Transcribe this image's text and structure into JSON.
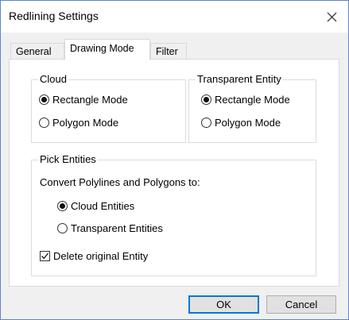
{
  "window": {
    "title": "Redlining Settings"
  },
  "tabs": [
    {
      "label": "General",
      "active": false
    },
    {
      "label": "Drawing Mode",
      "active": true
    },
    {
      "label": "Filter",
      "active": false
    }
  ],
  "cloud": {
    "title": "Cloud",
    "options": [
      {
        "label": "Rectangle Mode",
        "selected": true
      },
      {
        "label": "Polygon Mode",
        "selected": false
      }
    ]
  },
  "transparent_entity": {
    "title": "Transparent Entity",
    "options": [
      {
        "label": "Rectangle Mode",
        "selected": true
      },
      {
        "label": "Polygon Mode",
        "selected": false
      }
    ]
  },
  "pick_entities": {
    "title": "Pick Entities",
    "convert_label": "Convert Polylines and Polygons to:",
    "options": [
      {
        "label": "Cloud Entities",
        "selected": true
      },
      {
        "label": "Transparent Entities",
        "selected": false
      }
    ],
    "delete_original": {
      "label": "Delete original Entity",
      "checked": true
    }
  },
  "buttons": {
    "ok": "OK",
    "cancel": "Cancel"
  },
  "icons": {
    "close": "close-icon",
    "check": "checkmark-icon"
  }
}
